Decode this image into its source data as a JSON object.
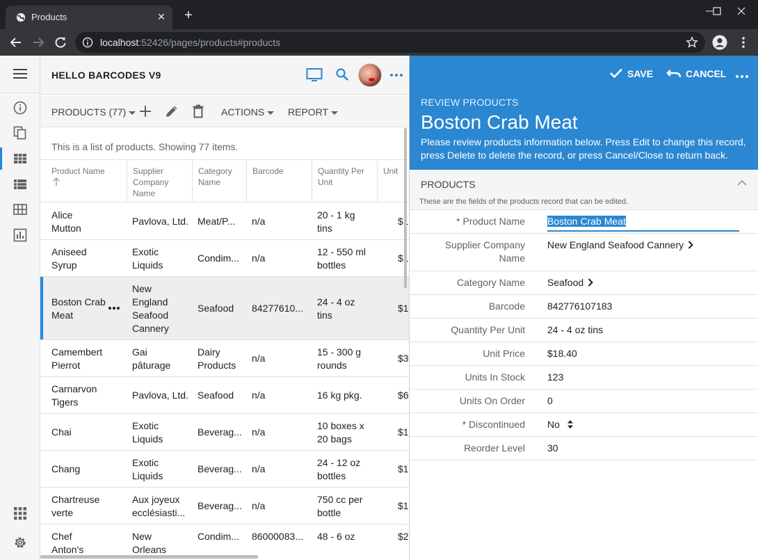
{
  "browser": {
    "tab_title": "Products",
    "url_host": "localhost",
    "url_rest": ":52426/pages/products#products"
  },
  "app": {
    "title": "HELLO BARCODES V9"
  },
  "list": {
    "view_label": "PRODUCTS (77)",
    "actions_label": "ACTIONS",
    "report_label": "REPORT",
    "summary": "This is a list of products. Showing 77 items.",
    "columns": [
      [
        "Product Name"
      ],
      [
        "Supplier",
        "Company",
        "Name"
      ],
      [
        "Category",
        "Name"
      ],
      [
        "Barcode"
      ],
      [
        "Quantity Per",
        "Unit"
      ],
      [
        "Unit"
      ]
    ],
    "rows": [
      {
        "product": [
          "Alice",
          "Mutton"
        ],
        "supplier": [
          "Pavlova, Ltd."
        ],
        "category": [
          "Meat/P..."
        ],
        "barcode": "n/a",
        "qty": [
          "20 - 1 kg",
          "tins"
        ],
        "price": "$1"
      },
      {
        "product": [
          "Aniseed",
          "Syrup"
        ],
        "supplier": [
          "Exotic",
          "Liquids"
        ],
        "category": [
          "Condim..."
        ],
        "barcode": "n/a",
        "qty": [
          "12 - 550 ml",
          "bottles"
        ],
        "price": "$1"
      },
      {
        "product": [
          "Boston Crab",
          "Meat"
        ],
        "supplier": [
          "New",
          "England",
          "Seafood",
          "Cannery"
        ],
        "category": [
          "Seafood"
        ],
        "barcode": "84277610...",
        "qty": [
          "24 - 4 oz",
          "tins"
        ],
        "price": "$1"
      },
      {
        "product": [
          "Camembert",
          "Pierrot"
        ],
        "supplier": [
          "Gai",
          "pâturage"
        ],
        "category": [
          "Dairy",
          "Products"
        ],
        "barcode": "n/a",
        "qty": [
          "15 - 300 g",
          "rounds"
        ],
        "price": "$3"
      },
      {
        "product": [
          "Carnarvon",
          "Tigers"
        ],
        "supplier": [
          "Pavlova, Ltd."
        ],
        "category": [
          "Seafood"
        ],
        "barcode": "n/a",
        "qty": [
          "16 kg pkg."
        ],
        "price": "$6"
      },
      {
        "product": [
          "Chai"
        ],
        "supplier": [
          "Exotic",
          "Liquids"
        ],
        "category": [
          "Beverag..."
        ],
        "barcode": "n/a",
        "qty": [
          "10 boxes x",
          "20 bags"
        ],
        "price": "$1"
      },
      {
        "product": [
          "Chang"
        ],
        "supplier": [
          "Exotic",
          "Liquids"
        ],
        "category": [
          "Beverag..."
        ],
        "barcode": "n/a",
        "qty": [
          "24 - 12 oz",
          "bottles"
        ],
        "price": "$1"
      },
      {
        "product": [
          "Chartreuse",
          "verte"
        ],
        "supplier": [
          "Aux joyeux",
          "ecclésiasti..."
        ],
        "category": [
          "Beverag..."
        ],
        "barcode": "n/a",
        "qty": [
          "750 cc per",
          "bottle"
        ],
        "price": "$1"
      },
      {
        "product": [
          "Chef",
          "Anton's"
        ],
        "supplier": [
          "New",
          "Orleans"
        ],
        "category": [
          "Condim..."
        ],
        "barcode": "86000083...",
        "qty": [
          "48 - 6 oz"
        ],
        "price": "$2"
      }
    ]
  },
  "form": {
    "save_label": "SAVE",
    "cancel_label": "CANCEL",
    "kicker": "REVIEW PRODUCTS",
    "title": "Boston Crab Meat",
    "description": "Please review products information below. Press Edit to change this record, press Delete to delete the record, or press Cancel/Close to return back.",
    "category_title": "PRODUCTS",
    "category_desc": "These are the fields of the products record that can be edited.",
    "fields": [
      {
        "label": [
          "* Product Name"
        ],
        "value": "Boston Crab Meat"
      },
      {
        "label": [
          "Supplier Company",
          "Name"
        ],
        "value": "New England Seafood Cannery"
      },
      {
        "label": [
          "Category Name"
        ],
        "value": "Seafood"
      },
      {
        "label": [
          "Barcode"
        ],
        "value": "842776107183"
      },
      {
        "label": [
          "Quantity Per Unit"
        ],
        "value": "24 - 4 oz tins"
      },
      {
        "label": [
          "Unit Price"
        ],
        "value": "$18.40"
      },
      {
        "label": [
          "Units In Stock"
        ],
        "value": "123"
      },
      {
        "label": [
          "Units On Order"
        ],
        "value": "0"
      },
      {
        "label": [
          "* Discontinued"
        ],
        "value": "No"
      },
      {
        "label": [
          "Reorder Level"
        ],
        "value": "30"
      }
    ]
  },
  "colors": {
    "accent": "#2b87d1",
    "selection_bar": "#1e88e5"
  }
}
